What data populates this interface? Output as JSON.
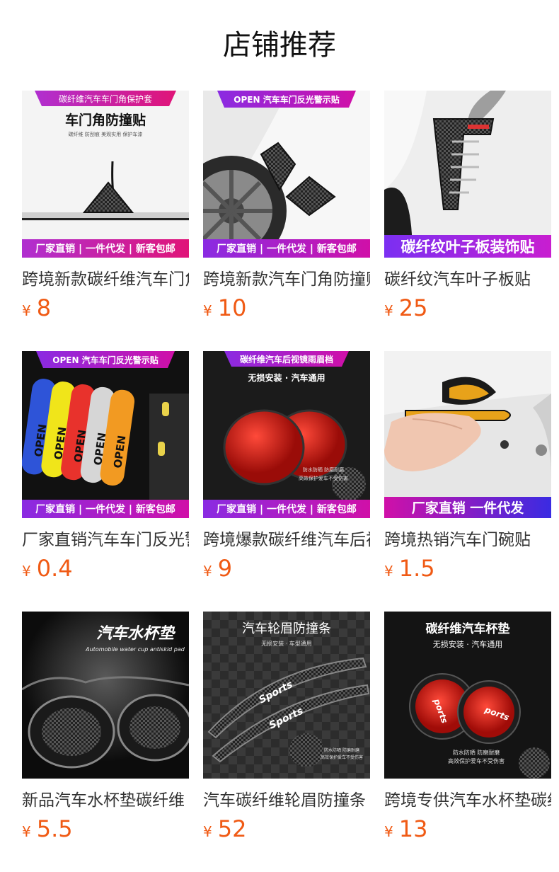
{
  "page_title": "店铺推荐",
  "colors": {
    "price": "#f05a14",
    "banner_purple": "#8a2be2",
    "banner_magenta": "#d010a8"
  },
  "products": [
    {
      "name": "跨境新款碳纤维汽车门角防撞贴",
      "currency": "¥",
      "price": "8",
      "image": {
        "top_banner": "碳纤维汽车车门角保护套",
        "headline": "车门角防撞贴",
        "subline": "碳纤维 防刮痕 美观实用 保护车漆",
        "bottom_banner": "厂家直销 | 一件代发 | 新客包邮"
      }
    },
    {
      "name": "跨境新款汽车门角防撞贴",
      "currency": "¥",
      "price": "10",
      "image": {
        "top_banner": "OPEN 汽车车门反光警示贴",
        "bottom_banner": "厂家直销 | 一件代发 | 新客包邮"
      }
    },
    {
      "name": "碳纤纹汽车叶子板贴",
      "currency": "¥",
      "price": "25",
      "image": {
        "bottom_banner": "碳纤纹叶子板装饰贴"
      }
    },
    {
      "name": "厂家直销汽车车门反光警示贴",
      "currency": "¥",
      "price": "0.4",
      "image": {
        "top_banner": "OPEN 汽车车门反光警示贴",
        "sticker_text": "OPEN",
        "bottom_banner": "厂家直销 | 一件代发 | 新客包邮"
      }
    },
    {
      "name": "跨境爆款碳纤维汽车后视镜雨眉",
      "currency": "¥",
      "price": "9",
      "image": {
        "top_banner": "碳纤维汽车后视镜雨眉档",
        "headline": "无损安装 · 汽车通用",
        "feature_1": "防水防晒 防磨耐磨",
        "feature_2": "高效保护爱车不受伤害",
        "bottom_banner": "厂家直销 | 一件代发 | 新客包邮"
      }
    },
    {
      "name": "跨境热销汽车门碗贴",
      "currency": "¥",
      "price": "1.5",
      "image": {
        "bottom_banner": "厂家直销  一件代发"
      }
    },
    {
      "name": "新品汽车水杯垫碳纤维",
      "currency": "¥",
      "price": "5.5",
      "image": {
        "headline": "汽车水杯垫",
        "subline": "Automobile water cup antiskid pad"
      }
    },
    {
      "name": "汽车碳纤维轮眉防撞条",
      "currency": "¥",
      "price": "52",
      "image": {
        "headline": "汽车轮眉防撞条",
        "subline": "无损安装 · 车型通用",
        "strip_text": "Sports",
        "feature_1": "防水防晒 防磨耐磨",
        "feature_2": "高效保护爱车不受伤害"
      }
    },
    {
      "name": "跨境专供汽车水杯垫碳纤维",
      "currency": "¥",
      "price": "13",
      "image": {
        "headline": "碳纤维汽车杯垫",
        "subline": "无损安装 · 汽车通用",
        "pad_text": "ports",
        "feature_1": "防水防晒 防磨耐磨",
        "feature_2": "高效保护爱车不受伤害"
      }
    }
  ]
}
